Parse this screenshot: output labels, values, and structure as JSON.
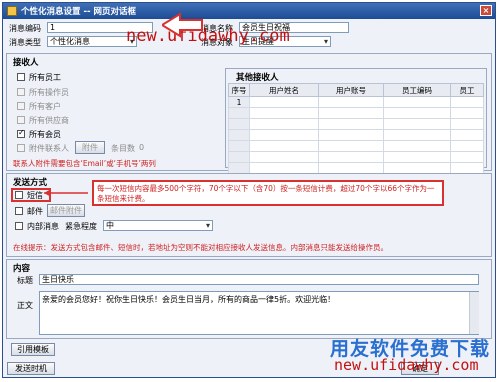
{
  "window": {
    "title": "个性化消息设置 -- 网页对话框",
    "close_glyph": "×"
  },
  "top": {
    "code_label": "消息编码",
    "code_value": "1",
    "type_label": "消息类型",
    "type_value": "个性化消息",
    "name_label": "消息名称",
    "name_value": "会员生日祝福",
    "object_label": "消息对象",
    "object_value": "生日提醒"
  },
  "receivers": {
    "heading": "接收人",
    "items": [
      {
        "label": "所有员工",
        "checked": false,
        "disabled": false
      },
      {
        "label": "所有操作员",
        "checked": false,
        "disabled": true
      },
      {
        "label": "所有客户",
        "checked": false,
        "disabled": true
      },
      {
        "label": "所有供应商",
        "checked": false,
        "disabled": true
      },
      {
        "label": "所有会员",
        "checked": true,
        "disabled": false
      },
      {
        "label": "附件联系人",
        "checked": false,
        "disabled": true
      }
    ],
    "attach_button": "附件",
    "count_label": "条目数",
    "count_value": "0",
    "hint": "联系人附件需要包含‘Email’或‘手机号’两列"
  },
  "other_receivers": {
    "heading": "其他接收人",
    "columns": [
      "序号",
      "用户姓名",
      "用户账号",
      "员工编码",
      "员工"
    ],
    "rows": [
      [
        "1",
        "",
        "",
        "",
        ""
      ],
      [
        "",
        "",
        "",
        "",
        ""
      ],
      [
        "",
        "",
        "",
        "",
        ""
      ],
      [
        "",
        "",
        "",
        "",
        ""
      ],
      [
        "",
        "",
        "",
        "",
        ""
      ],
      [
        "",
        "",
        "",
        "",
        ""
      ],
      [
        "",
        "",
        "",
        "",
        ""
      ]
    ]
  },
  "send": {
    "heading": "发送方式",
    "sms_label": "短信",
    "mail_label": "邮件",
    "mail_attach_button": "邮件附件",
    "internal_label": "内部消息",
    "urgency_label": "紧急程度",
    "urgency_value": "中",
    "tip": "在线提示：发送方式包含邮件、短信时，若地址为空则不能对相应接收人发送信息。内部消息只能发送给操作员。"
  },
  "annotation": "每一次短信内容最多500个字符，70个字以下（含70）按一条短信计费，超过70个字以66个字作为一条短信来计费。",
  "content": {
    "heading": "内容",
    "title_label": "标题",
    "title_value": "生日快乐",
    "body_label": "正文",
    "body_value": "亲爱的会员您好！祝你生日快乐！会员生日当月，所有的商品一律5折。欢迎光临！"
  },
  "buttons": {
    "template": "引用模板",
    "send_time": "发送时机",
    "ok": "确定"
  },
  "watermark": {
    "url": "new.ufidawhy.com",
    "brand": "用友软件免费下载"
  }
}
